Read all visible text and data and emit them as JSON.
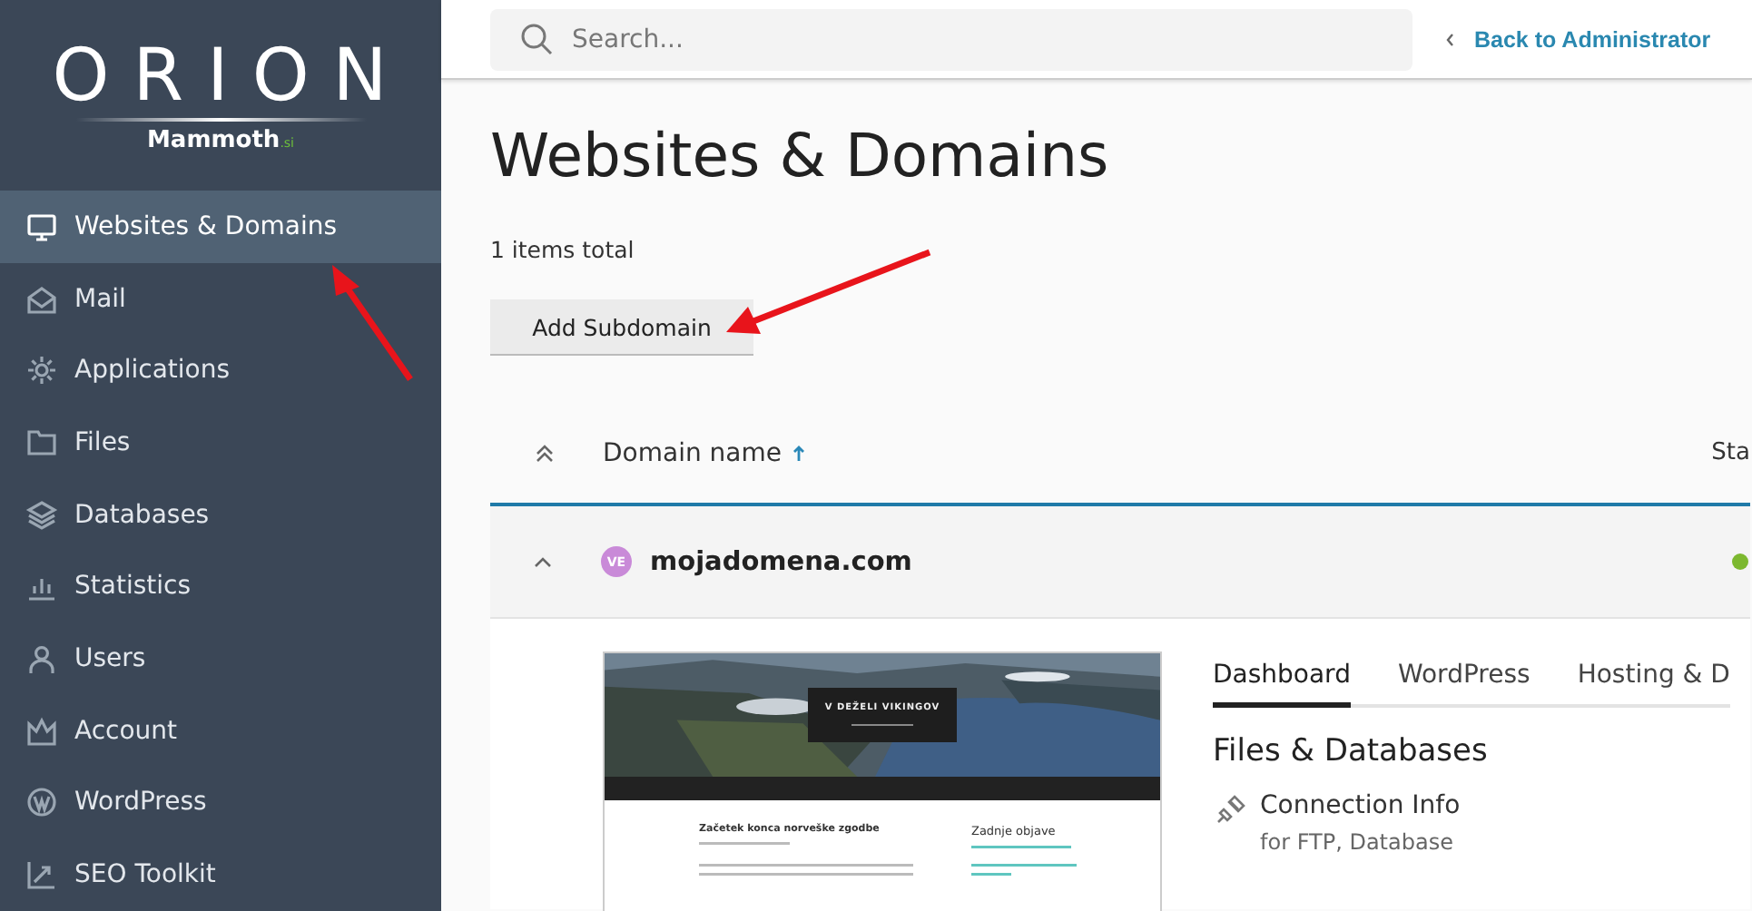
{
  "sidebar": {
    "logo": {
      "title": "ORION",
      "brand": "Mammoth",
      "suffix": ".si"
    },
    "items": [
      {
        "label": "Websites & Domains",
        "selected": true
      },
      {
        "label": "Mail",
        "selected": false
      },
      {
        "label": "Applications",
        "selected": false
      },
      {
        "label": "Files",
        "selected": false
      },
      {
        "label": "Databases",
        "selected": false
      },
      {
        "label": "Statistics",
        "selected": false
      },
      {
        "label": "Users",
        "selected": false
      },
      {
        "label": "Account",
        "selected": false
      },
      {
        "label": "WordPress",
        "selected": false
      },
      {
        "label": "SEO Toolkit",
        "selected": false
      }
    ]
  },
  "topbar": {
    "search": {
      "placeholder": "Search..."
    },
    "back_link": "Back to Administrator"
  },
  "page": {
    "title": "Websites & Domains",
    "count": "1 items total",
    "button": "Add Subdomain"
  },
  "table": {
    "columns": [
      {
        "label": "Domain name",
        "sorted": true
      },
      {
        "label": "Sta",
        "sorted": false
      }
    ],
    "rows": [
      {
        "domain": "mojadomena.com",
        "avatar": "VE",
        "expanded": true,
        "active": true
      }
    ]
  },
  "preview": {
    "site_title": "V DEŽELI VIKINGOV",
    "post_title": "Začetek konca norveške zgodbe",
    "sidebar_heading": "Zadnje objave"
  },
  "tabs": [
    {
      "label": "Dashboard",
      "selected": true
    },
    {
      "label": "WordPress",
      "selected": false
    },
    {
      "label": "Hosting & D",
      "selected": false
    }
  ],
  "section": {
    "title": "Files & Databases",
    "links": [
      {
        "title": "Connection Info",
        "subtitle": "for FTP, Database"
      }
    ]
  }
}
